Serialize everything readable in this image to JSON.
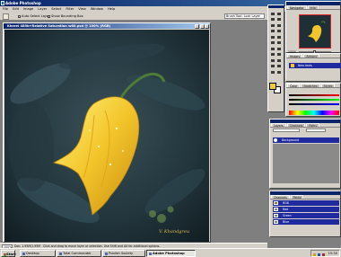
{
  "app": {
    "title": "Adobe Photoshop",
    "window_buttons": [
      "_",
      "□",
      "×"
    ]
  },
  "menu": [
    "File",
    "Edit",
    "Image",
    "Layer",
    "Select",
    "Filter",
    "View",
    "Window",
    "Help"
  ],
  "options_bar": {
    "auto_select_layer": "Auto Select Layer",
    "show_bounding_box": "Show Bounding Box",
    "field_text": "Brush Tool: Lock Layer"
  },
  "document": {
    "title": "Kherel 489b+Relative Saturation w60.psd @ 100% (RGB)",
    "signature": "V. Khandgreu"
  },
  "navigator": {
    "tabs": [
      "Navigator",
      "Info"
    ],
    "zoom": "100%"
  },
  "history": {
    "tabs": [
      "History",
      "Actions"
    ],
    "items": [
      "New texts"
    ]
  },
  "color": {
    "tabs": [
      "Color",
      "Swatches",
      "Styles"
    ]
  },
  "layers": {
    "tabs": [
      "Layers",
      "Channels",
      "Paths"
    ],
    "items": [
      "Background"
    ]
  },
  "channels": {
    "tabs": [
      "Channels",
      "Paths"
    ],
    "items": [
      "RGB",
      "Red",
      "Green",
      "Blue"
    ]
  },
  "status": {
    "zoom": "100%",
    "doc_size": "Doc: 1.95M/1.95M",
    "hint": "Click and drag to move layer or selection. Use Shift and Alt for additional options."
  },
  "taskbar": {
    "start": "Start",
    "buttons": [
      "Desktop",
      "Total Commander",
      "Publish Society",
      "Adobe Photoshop"
    ],
    "active_index": 3,
    "clock": "15:30"
  },
  "colors": {
    "foreground": "#f0d020",
    "background": "#ffffff",
    "title_blue": "#0a246a",
    "selection_blue": "#1e2a9e"
  }
}
